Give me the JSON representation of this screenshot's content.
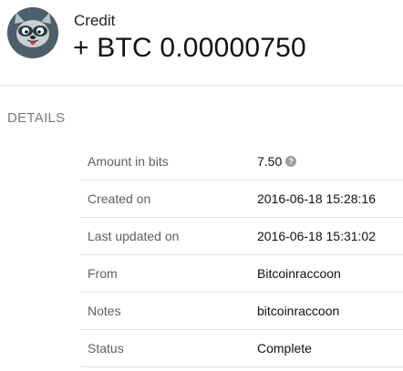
{
  "header": {
    "type_label": "Credit",
    "amount": "+ BTC 0.00000750",
    "avatar_icon": "raccoon-avatar-icon"
  },
  "section": {
    "title": "DETAILS"
  },
  "details": [
    {
      "label": "Amount in bits",
      "value": "7.50",
      "help_icon": "help-icon",
      "help_glyph": "?"
    },
    {
      "label": "Created on",
      "value": "2016-06-18 15:28:16"
    },
    {
      "label": "Last updated on",
      "value": "2016-06-18 15:31:02"
    },
    {
      "label": "From",
      "value": "Bitcoinraccoon"
    },
    {
      "label": "Notes",
      "value": "bitcoinraccoon"
    },
    {
      "label": "Status",
      "value": "Complete"
    }
  ],
  "colors": {
    "divider": "#e3e3e3",
    "label_text": "#5f5f5f",
    "section_title": "#7a7a7a",
    "help_icon_bg": "#9e9e9e",
    "avatar_bg": "#4d5f6a"
  }
}
